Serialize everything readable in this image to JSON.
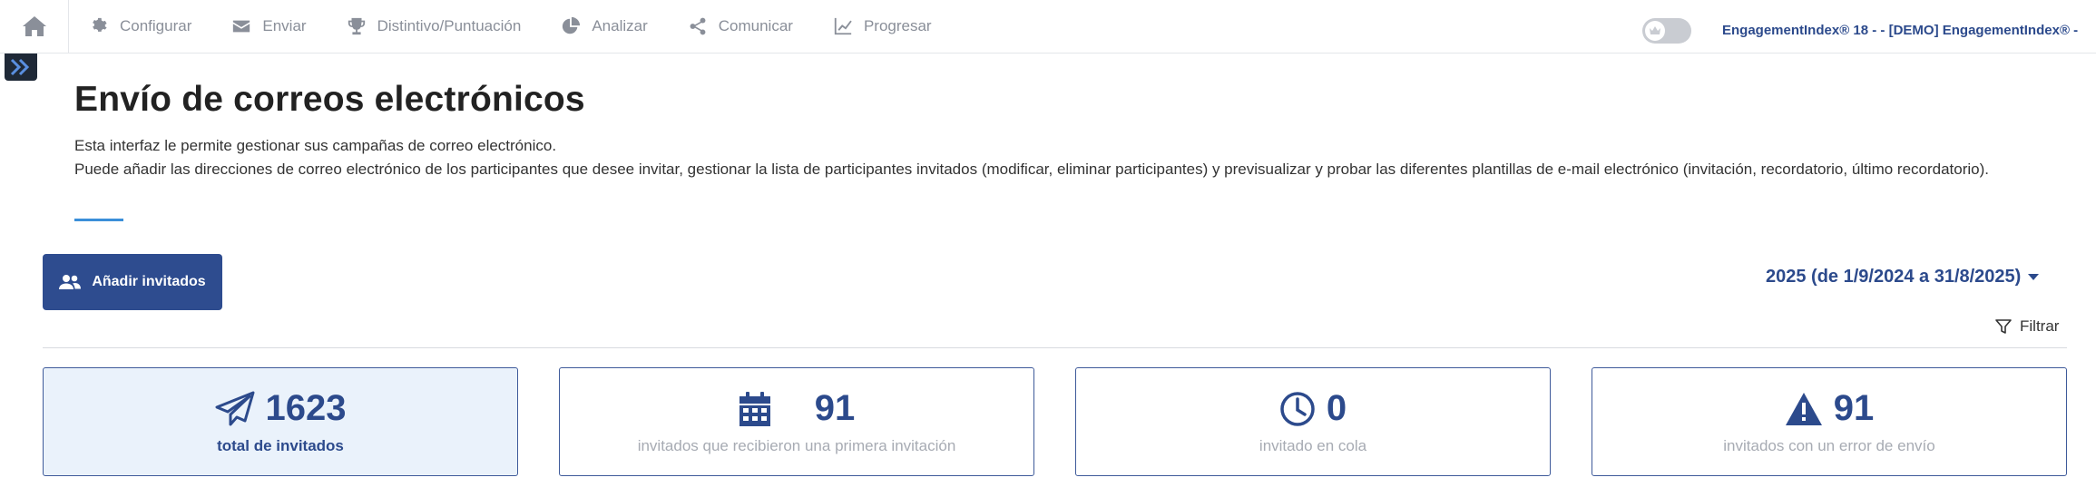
{
  "nav": {
    "items": [
      {
        "label": "Configurar",
        "icon": "gear-icon"
      },
      {
        "label": "Enviar",
        "icon": "envelope-icon"
      },
      {
        "label": "Distintivo/Puntuación",
        "icon": "trophy-icon"
      },
      {
        "label": "Analizar",
        "icon": "pie-chart-icon"
      },
      {
        "label": "Comunicar",
        "icon": "share-icon"
      },
      {
        "label": "Progresar",
        "icon": "line-chart-icon"
      }
    ],
    "org_label": "EngagementIndex® 18 - - [DEMO] EngagementIndex® -"
  },
  "page": {
    "title": "Envío de correos electrónicos",
    "description_line1": "Esta interfaz le permite gestionar sus campañas de correo electrónico.",
    "description_line2": "Puede añadir las direcciones de correo electrónico de los participantes que desee invitar, gestionar la lista de participantes invitados (modificar, eliminar participantes) y previsualizar y probar las diferentes plantillas de e-mail electrónico (invitación, recordatorio, último recordatorio)."
  },
  "toolbar": {
    "add_label": "Añadir invitados",
    "period_label": "2025 (de 1/9/2024 a 31/8/2025)",
    "filter_label": "Filtrar"
  },
  "stats": [
    {
      "value": "1623",
      "label": "total de invitados",
      "icon": "paper-plane-icon"
    },
    {
      "value": "91",
      "label": "invitados que recibieron una primera invitación",
      "icon": "calendar-icon"
    },
    {
      "value": "0",
      "label": "invitado en cola",
      "icon": "clock-icon"
    },
    {
      "value": "91",
      "label": "invitados con un error de envío",
      "icon": "warning-icon"
    }
  ],
  "colors": {
    "accent": "#2e4c8f",
    "underline": "#3b8fd9",
    "active_card_bg": "#eaf2fb"
  }
}
